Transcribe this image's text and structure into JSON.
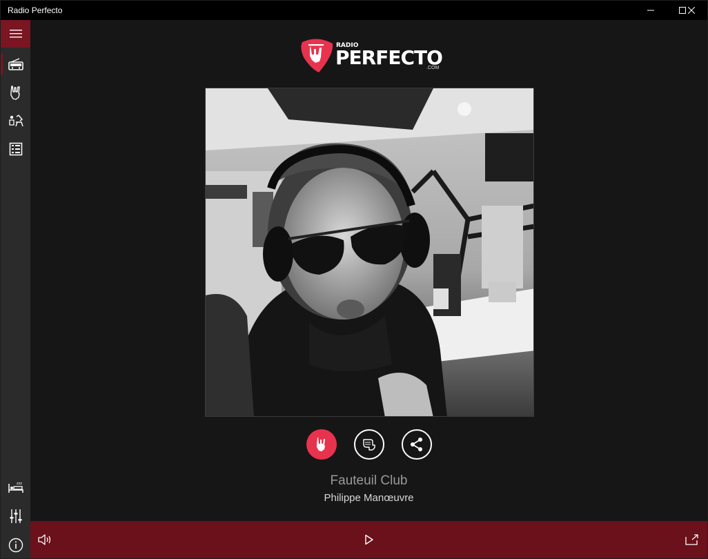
{
  "window": {
    "title": "Radio Perfecto"
  },
  "logo": {
    "radio": "RADIO",
    "brand": "PERFECTO",
    "com": ".COM"
  },
  "nav": {
    "items": [
      {
        "icon": "radio-icon",
        "active": true
      },
      {
        "icon": "rock-hand-icon",
        "active": false
      },
      {
        "icon": "dj-icon",
        "active": false
      },
      {
        "icon": "schedule-icon",
        "active": false
      }
    ],
    "bottom": [
      {
        "icon": "sleep-icon"
      },
      {
        "icon": "equalizer-icon"
      },
      {
        "icon": "info-icon"
      }
    ]
  },
  "now_playing": {
    "title": "Fauteuil Club",
    "artist": "Philippe Manœuvre"
  },
  "colors": {
    "accent": "#7a1522",
    "like": "#e8334e",
    "player_bar": "#6a111b",
    "sidebar": "#2b2b2b",
    "background": "#161616"
  }
}
